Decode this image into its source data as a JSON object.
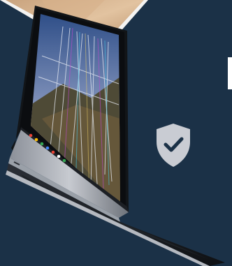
{
  "background_color": "#1b3147",
  "photo_corner": {
    "content": "wooden-desk-photo"
  },
  "laptop": {
    "screen_content": "mountain-landscape-wallpaper-with-cracked-glitch-lines",
    "taskbar_icon_count": 7
  },
  "badge": {
    "icon": "shield-check-icon",
    "color": "#c9ccd3"
  }
}
